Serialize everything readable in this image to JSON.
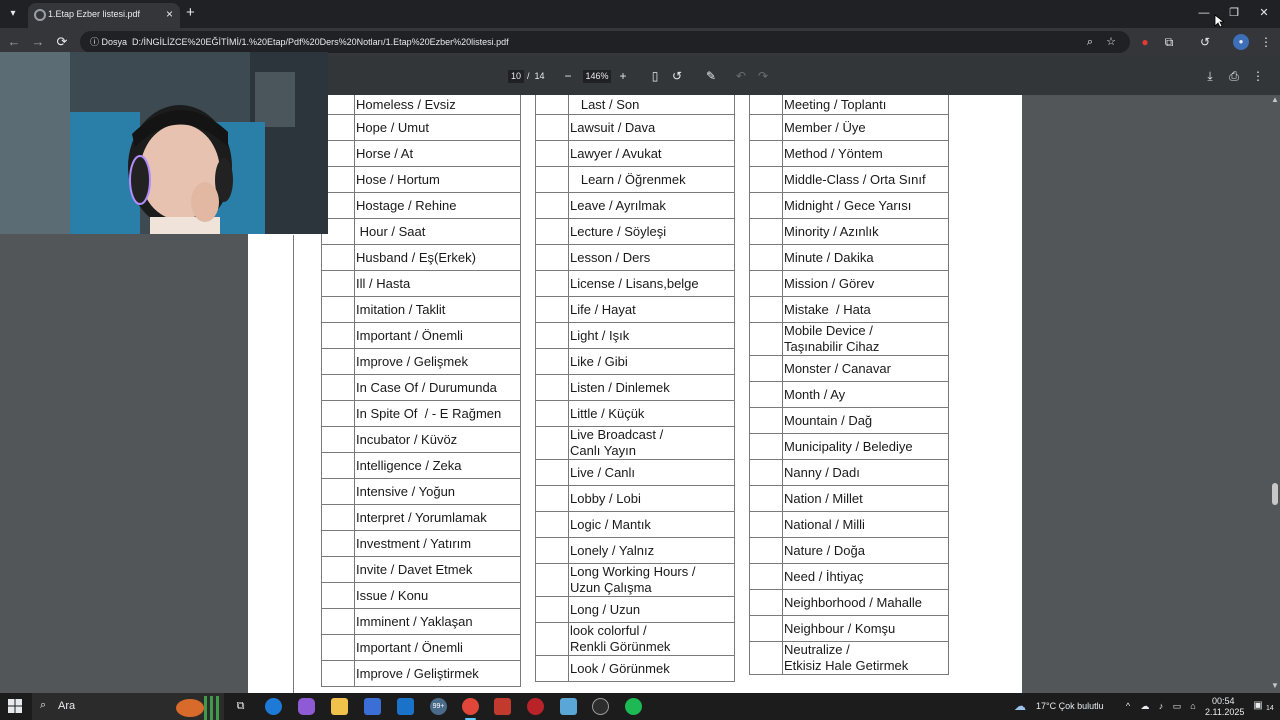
{
  "browser": {
    "tab_title": "1.Etap Ezber listesi.pdf",
    "new_tab_symbol": "+",
    "tab_close_symbol": "×",
    "url_chip": "Dosya",
    "url": "D:/İNGİLİZCE%20EĞİTİMİ/1.%20Etap/Pdf%20Ders%20Notları/1.Etap%20Ezber%20listesi.pdf",
    "window_controls": {
      "minimize": "—",
      "restore": "❐",
      "close": "✕"
    }
  },
  "pdf_toolbar": {
    "current_page": "10",
    "page_separator": "/",
    "total_pages": "14",
    "zoom": "146%",
    "zoom_out": "−",
    "zoom_in": "+"
  },
  "document": {
    "columns": [
      [
        {
          "text": "Homeless / Evsiz",
          "lines": 1
        },
        {
          "text": "Hope / Umut",
          "lines": 1
        },
        {
          "text": "Horse / At",
          "lines": 1
        },
        {
          "text": "Hose / Hortum",
          "lines": 1
        },
        {
          "text": "Hostage / Rehine",
          "lines": 1
        },
        {
          "text": " Hour / Saat",
          "lines": 1
        },
        {
          "text": "Husband / Eş(Erkek)",
          "lines": 1
        },
        {
          "text": "Ill / Hasta",
          "lines": 1
        },
        {
          "text": "Imitation / Taklit",
          "lines": 1
        },
        {
          "text": "Important / Önemli",
          "lines": 1
        },
        {
          "text": "Improve / Gelişmek",
          "lines": 1
        },
        {
          "text": "In Case Of / Durumunda",
          "lines": 1
        },
        {
          "text": "In Spite Of  / - E Rağmen",
          "lines": 1
        },
        {
          "text": "Incubator / Küvöz",
          "lines": 1
        },
        {
          "text": "Intelligence / Zeka",
          "lines": 1
        },
        {
          "text": "Intensive / Yoğun",
          "lines": 1
        },
        {
          "text": "Interpret / Yorumlamak",
          "lines": 1
        },
        {
          "text": "Investment / Yatırım",
          "lines": 1
        },
        {
          "text": "Invite / Davet Etmek",
          "lines": 1
        },
        {
          "text": "Issue / Konu",
          "lines": 1
        },
        {
          "text": "Imminent / Yaklaşan",
          "lines": 1
        },
        {
          "text": "Important / Önemli",
          "lines": 1
        },
        {
          "text": "Improve / Geliştirmek",
          "lines": 1
        }
      ],
      [
        {
          "text": "   Last / Son",
          "lines": 1
        },
        {
          "text": "Lawsuit / Dava",
          "lines": 1
        },
        {
          "text": "Lawyer / Avukat",
          "lines": 1
        },
        {
          "text": "   Learn / Öğrenmek",
          "lines": 1
        },
        {
          "text": "Leave / Ayrılmak",
          "lines": 1
        },
        {
          "text": "Lecture / Söyleşi",
          "lines": 1
        },
        {
          "text": "Lesson / Ders",
          "lines": 1
        },
        {
          "text": "License / Lisans,belge",
          "lines": 1
        },
        {
          "text": "Life / Hayat",
          "lines": 1
        },
        {
          "text": "Light / Işık",
          "lines": 1
        },
        {
          "text": "Like / Gibi",
          "lines": 1
        },
        {
          "text": "Listen / Dinlemek",
          "lines": 1
        },
        {
          "text": "Little / Küçük",
          "lines": 1
        },
        {
          "text": "Live Broadcast /",
          "text2": "Canlı Yayın",
          "lines": 2
        },
        {
          "text": "Live / Canlı",
          "lines": 1
        },
        {
          "text": "Lobby / Lobi",
          "lines": 1
        },
        {
          "text": "Logic / Mantık",
          "lines": 1
        },
        {
          "text": "Lonely / Yalnız",
          "lines": 1
        },
        {
          "text": "Long Working Hours /",
          "text2": "Uzun Çalışma",
          "lines": 2
        },
        {
          "text": "Long / Uzun",
          "lines": 1
        },
        {
          "text": "look colorful /",
          "text2": "Renkli Görünmek",
          "lines": 2
        },
        {
          "text": "Look / Görünmek",
          "lines": 1
        }
      ],
      [
        {
          "text": "Meeting / Toplantı",
          "lines": 1
        },
        {
          "text": "Member / Üye",
          "lines": 1
        },
        {
          "text": "Method / Yöntem",
          "lines": 1
        },
        {
          "text": "Middle-Class / Orta Sınıf",
          "lines": 1
        },
        {
          "text": "Midnight / Gece Yarısı",
          "lines": 1
        },
        {
          "text": "Minority / Azınlık",
          "lines": 1
        },
        {
          "text": "Minute / Dakika",
          "lines": 1
        },
        {
          "text": "Mission / Görev",
          "lines": 1
        },
        {
          "text": "Mistake  / Hata",
          "lines": 1
        },
        {
          "text": "Mobile Device /",
          "text2": "Taşınabilir Cihaz",
          "lines": 2
        },
        {
          "text": "Monster / Canavar",
          "lines": 1
        },
        {
          "text": "Month / Ay",
          "lines": 1
        },
        {
          "text": "Mountain / Dağ",
          "lines": 1
        },
        {
          "text": "Municipality / Belediye",
          "lines": 1
        },
        {
          "text": "Nanny / Dadı",
          "lines": 1
        },
        {
          "text": "Nation / Millet",
          "lines": 1
        },
        {
          "text": "National / Milli",
          "lines": 1
        },
        {
          "text": "Nature / Doğa",
          "lines": 1
        },
        {
          "text": "Need / İhtiyaç",
          "lines": 1
        },
        {
          "text": "Neighborhood / Mahalle",
          "lines": 1
        },
        {
          "text": "Neighbour / Komşu",
          "lines": 1
        },
        {
          "text": "Neutralize /",
          "text2": "Etkisiz Hale Getirmek",
          "lines": 2
        }
      ]
    ]
  },
  "taskbar": {
    "search_placeholder": "Ara",
    "weather": "17°C  Çok bulutlu",
    "time": "00:54",
    "date": "2.11.2025",
    "mail_badge": "99+",
    "notification_count": "14"
  }
}
